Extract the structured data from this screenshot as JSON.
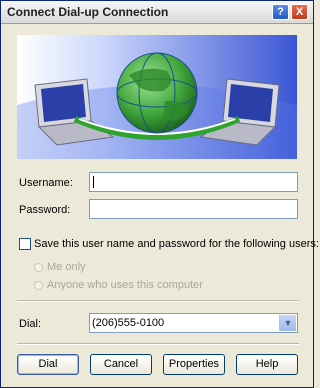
{
  "window": {
    "title": "Connect Dial-up Connection",
    "help_button": "?",
    "close_button": "X"
  },
  "form": {
    "username_label": "Username:",
    "username_value": "",
    "password_label": "Password:",
    "password_value": "",
    "save_checkbox_label": "Save this user name and password for the following users:",
    "save_checked": false,
    "radio_me_only": "Me only",
    "radio_anyone": "Anyone who uses this computer",
    "dial_label": "Dial:",
    "dial_value": "(206)555-0100",
    "dial_arrow": "▼"
  },
  "buttons": {
    "dial": "Dial",
    "cancel": "Cancel",
    "properties": "Properties",
    "help": "Help"
  },
  "colors": {
    "banner_blue": "#3b55d6",
    "globe_green": "#3fa53a"
  }
}
